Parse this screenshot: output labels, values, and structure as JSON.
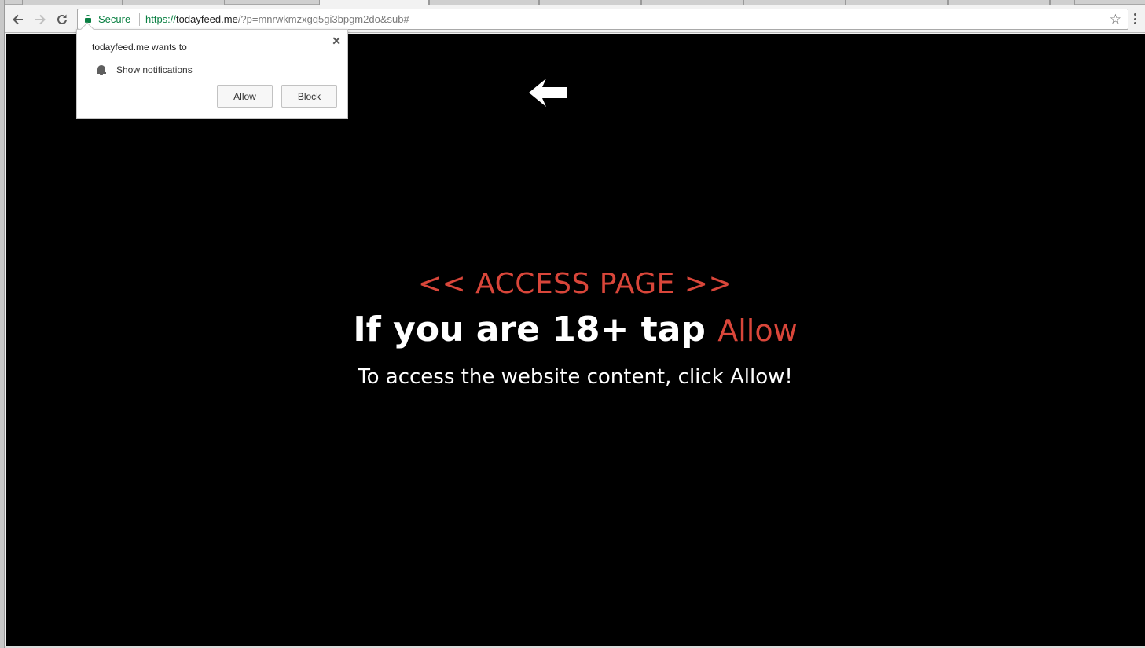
{
  "browser": {
    "nav": {
      "back_icon": "arrow-left-icon",
      "forward_icon": "arrow-right-icon",
      "reload_icon": "reload-icon"
    },
    "omnibox": {
      "security_label": "Secure",
      "url_scheme": "https://",
      "url_host": "todayfeed.me",
      "url_rest": "/?p=mnrwkmzxgq5gi3bpgm2do&sub#"
    },
    "icons": {
      "star": "☆",
      "close": "✕"
    }
  },
  "permission_popup": {
    "title": "todayfeed.me wants to",
    "permission": "Show notifications",
    "allow_label": "Allow",
    "block_label": "Block",
    "close": "✕"
  },
  "page": {
    "access_heading": "<< ACCESS PAGE >>",
    "headline_prefix": "If you are 18+ tap",
    "headline_allow": "Allow",
    "subtext": "To access the website content, click Allow!",
    "colors": {
      "background": "#000000",
      "accent": "#d9463a",
      "text": "#ffffff"
    }
  }
}
